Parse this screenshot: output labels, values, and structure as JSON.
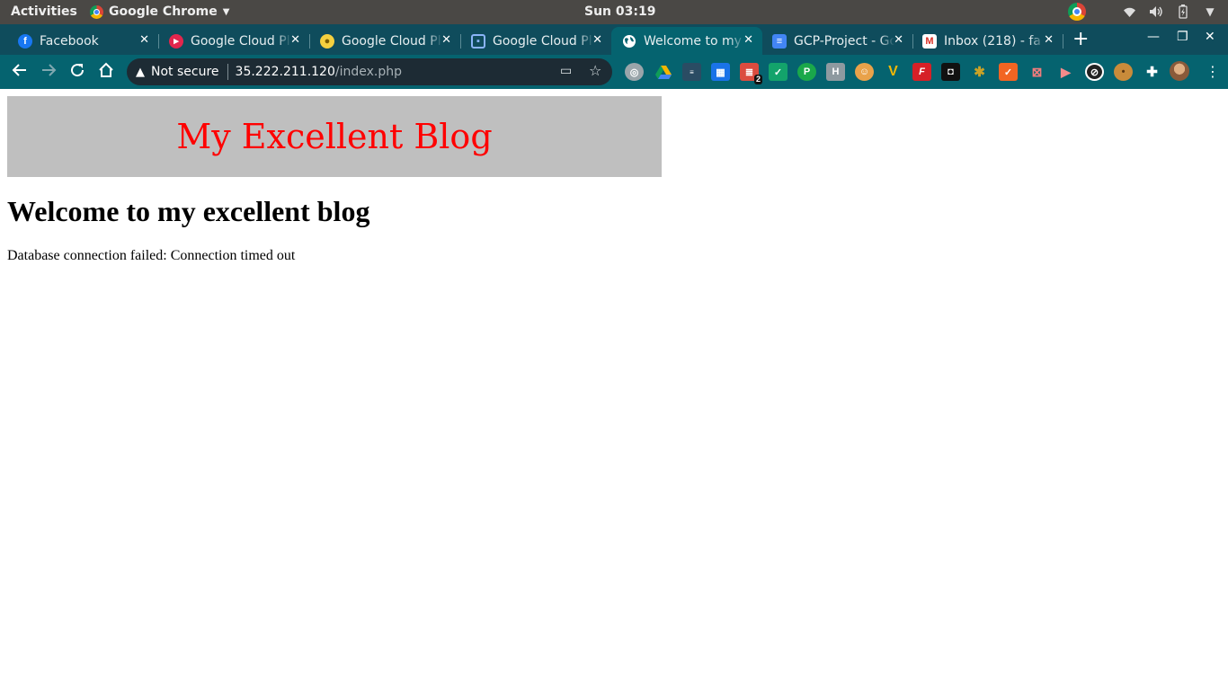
{
  "system_bar": {
    "activities": "Activities",
    "app_name": "Google Chrome",
    "clock": "Sun 03:19"
  },
  "tabs": [
    {
      "title": "Facebook",
      "icon": "facebook-icon",
      "color": "#1877f2",
      "active": false
    },
    {
      "title": "Google Cloud Platform",
      "icon": "cloud-platform-icon",
      "color": "#e2264d",
      "active": false
    },
    {
      "title": "Google Cloud Platform",
      "icon": "lightbulb-icon",
      "color": "#f4d03f",
      "active": false
    },
    {
      "title": "Google Cloud Platform",
      "icon": "chip-icon",
      "color": "#4285f4",
      "active": false
    },
    {
      "title": "Welcome to my excellent blog",
      "icon": "globe-icon",
      "color": "#ffffff",
      "active": true
    },
    {
      "title": "GCP-Project - Google Docs",
      "icon": "docs-icon",
      "color": "#4285f4",
      "active": false
    },
    {
      "title": "Inbox (218) - fa",
      "icon": "gmail-icon",
      "color": "#d93025",
      "active": false
    }
  ],
  "address_bar": {
    "security": "Not secure",
    "host": "35.222.211.120",
    "path": "/index.php"
  },
  "extensions": [
    {
      "name": "chrome-ext-icon",
      "color": "#9aa5aa"
    },
    {
      "name": "drive-icon",
      "color": "#0f9d58"
    },
    {
      "name": "news-icon",
      "color": "#2a4c63"
    },
    {
      "name": "calendar-icon",
      "color": "#1a73e8"
    },
    {
      "name": "todoist-icon",
      "color": "#db4c3f",
      "badge": "2"
    },
    {
      "name": "check-icon",
      "color": "#13a36b"
    },
    {
      "name": "p-ext-icon",
      "color": "#1aa84a"
    },
    {
      "name": "h-ext-icon",
      "color": "#8e9aa0"
    },
    {
      "name": "face-ext-icon",
      "color": "#e9a24a"
    },
    {
      "name": "v-ext-icon",
      "color": "#f2b806"
    },
    {
      "name": "f-ext-icon",
      "color": "#d62027"
    },
    {
      "name": "lens-ext-icon",
      "color": "#111111"
    },
    {
      "name": "tree-ext-icon",
      "color": "#c9a227"
    },
    {
      "name": "orange-check-icon",
      "color": "#f26522"
    },
    {
      "name": "robot-ext-icon",
      "color": "#f07c7c"
    },
    {
      "name": "camera-ext-icon",
      "color": "#f58b8b"
    },
    {
      "name": "block-ext-icon",
      "color": "#222222"
    },
    {
      "name": "cookie-icon",
      "color": "#c98b3a"
    },
    {
      "name": "puzzle-icon",
      "color": "#ffffff"
    }
  ],
  "page": {
    "blog_title": "My Excellent Blog",
    "heading": "Welcome to my excellent blog",
    "error_message": "Database connection failed: Connection timed out"
  }
}
